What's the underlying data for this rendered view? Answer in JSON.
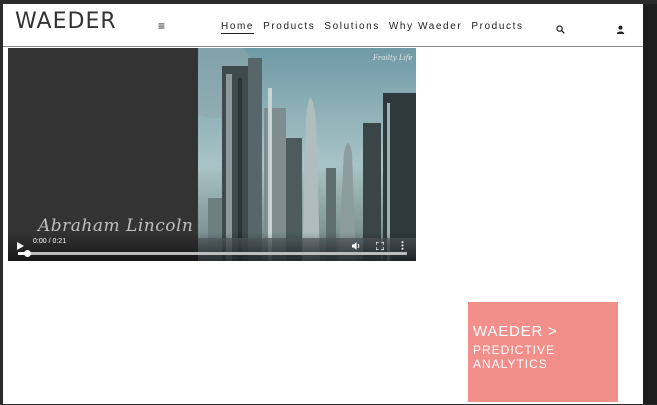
{
  "header": {
    "logo": "WAEDER",
    "menu_icon": "hamburger-menu-icon",
    "nav": [
      {
        "label": "Home",
        "active": true
      },
      {
        "label": "Products",
        "active": false
      },
      {
        "label": "Solutions",
        "active": false
      },
      {
        "label": "Why Waeder",
        "active": false
      },
      {
        "label": "Products",
        "active": false
      }
    ],
    "search_icon": "search-icon",
    "account_icon": "user-icon"
  },
  "video": {
    "signature": "Abraham Lincoln",
    "watermark": "Frailty Life",
    "time_display": "0:00 / 0:21",
    "progress_fraction": 0.02
  },
  "card": {
    "title": "WAEDER >",
    "subtitle": "PREDICTIVE ANALYTICS",
    "background": "#f28f8b"
  }
}
